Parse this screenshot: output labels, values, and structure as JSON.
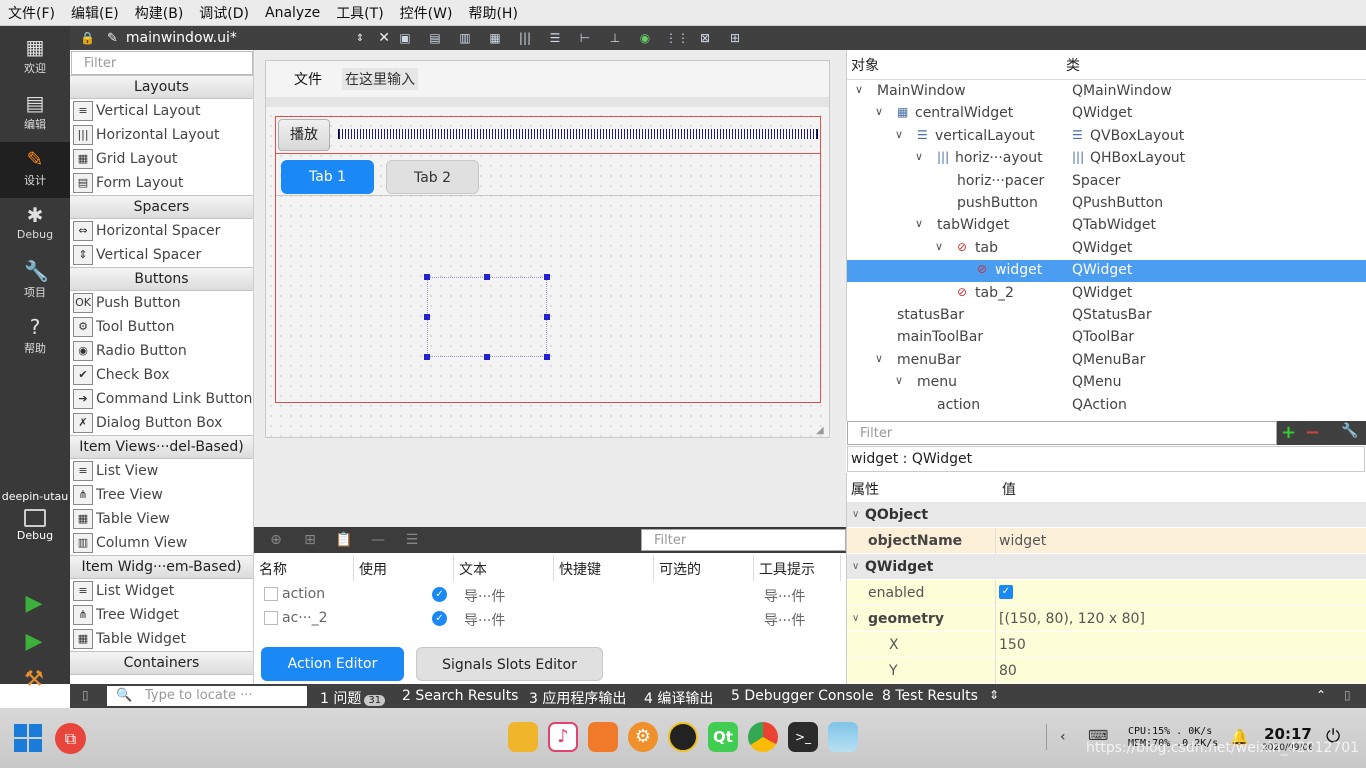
{
  "menubar": [
    "文件(F)",
    "编辑(E)",
    "构建(B)",
    "调试(D)",
    "Analyze",
    "工具(T)",
    "控件(W)",
    "帮助(H)"
  ],
  "modes": [
    {
      "label": "欢迎",
      "icon": "grid-icon"
    },
    {
      "label": "编辑",
      "icon": "document-icon"
    },
    {
      "label": "设计",
      "icon": "pencil-icon"
    },
    {
      "label": "Debug",
      "icon": "bug-icon"
    },
    {
      "label": "项目",
      "icon": "wrench-icon"
    },
    {
      "label": "帮助",
      "icon": "help-icon"
    }
  ],
  "kit": {
    "name": "deepin-utau",
    "mode": "Debug"
  },
  "editor": {
    "filename": "mainwindow.ui*"
  },
  "widgetbox": {
    "filter_placeholder": "Filter",
    "categories": [
      {
        "name": "Layouts",
        "items": [
          "Vertical Layout",
          "Horizontal Layout",
          "Grid Layout",
          "Form Layout"
        ]
      },
      {
        "name": "Spacers",
        "items": [
          "Horizontal Spacer",
          "Vertical Spacer"
        ]
      },
      {
        "name": "Buttons",
        "items": [
          "Push Button",
          "Tool Button",
          "Radio Button",
          "Check Box",
          "Command Link Button",
          "Dialog Button Box"
        ]
      },
      {
        "name": "Item Views···del-Based)",
        "items": [
          "List View",
          "Tree View",
          "Table View",
          "Column View"
        ]
      },
      {
        "name": "Item Widg···em-Based)",
        "items": [
          "List Widget",
          "Tree Widget",
          "Table Widget"
        ]
      },
      {
        "name": "Containers",
        "items": []
      }
    ]
  },
  "form": {
    "menu_file": "文件",
    "menu_typehere": "在这里输入",
    "play_button": "播放",
    "tab1": "Tab 1",
    "tab2": "Tab 2"
  },
  "action_editor": {
    "filter_placeholder": "Filter",
    "columns": [
      "名称",
      "使用",
      "文本",
      "快捷键",
      "可选的",
      "工具提示"
    ],
    "rows": [
      {
        "name": "action",
        "used": true,
        "text": "导···件",
        "tooltip": "导···件"
      },
      {
        "name": "ac···_2",
        "used": true,
        "text": "导···件",
        "tooltip": "导···件"
      }
    ],
    "tab_action": "Action Editor",
    "tab_signals": "Signals  Slots Editor"
  },
  "object_inspector": {
    "col_object": "对象",
    "col_class": "类",
    "rows": [
      {
        "object": "MainWindow",
        "class": "QMainWindow",
        "depth": 0,
        "exp": true
      },
      {
        "object": "centralWidget",
        "class": "QWidget",
        "depth": 1,
        "exp": true
      },
      {
        "object": "verticalLayout",
        "class": "QVBoxLayout",
        "depth": 2,
        "exp": true
      },
      {
        "object": "horiz···ayout",
        "class": "QHBoxLayout",
        "depth": 3,
        "exp": true
      },
      {
        "object": "horiz···pacer",
        "class": "Spacer",
        "depth": 4,
        "exp": false
      },
      {
        "object": "pushButton",
        "class": "QPushButton",
        "depth": 4,
        "exp": false
      },
      {
        "object": "tabWidget",
        "class": "QTabWidget",
        "depth": 3,
        "exp": true
      },
      {
        "object": "tab",
        "class": "QWidget",
        "depth": 4,
        "exp": true
      },
      {
        "object": "widget",
        "class": "QWidget",
        "depth": 5,
        "exp": false,
        "selected": true
      },
      {
        "object": "tab_2",
        "class": "QWidget",
        "depth": 4,
        "exp": false
      },
      {
        "object": "statusBar",
        "class": "QStatusBar",
        "depth": 1,
        "exp": false
      },
      {
        "object": "mainToolBar",
        "class": "QToolBar",
        "depth": 1,
        "exp": false
      },
      {
        "object": "menuBar",
        "class": "QMenuBar",
        "depth": 1,
        "exp": true
      },
      {
        "object": "menu",
        "class": "QMenu",
        "depth": 2,
        "exp": true
      },
      {
        "object": "action",
        "class": "QAction",
        "depth": 3,
        "exp": false
      }
    ]
  },
  "property_editor": {
    "filter_placeholder": "Filter",
    "object_label": "widget : QWidget",
    "col_property": "属性",
    "col_value": "值",
    "rows": [
      {
        "name": "QObject",
        "value": "",
        "kind": "group"
      },
      {
        "name": "objectName",
        "value": "widget",
        "kind": "bold"
      },
      {
        "name": "QWidget",
        "value": "",
        "kind": "group"
      },
      {
        "name": "enabled",
        "value": "",
        "kind": "check"
      },
      {
        "name": "geometry",
        "value": "[(150, 80), 120 x 80]",
        "kind": "boldexp"
      },
      {
        "name": "X",
        "value": "150",
        "kind": "sub"
      },
      {
        "name": "Y",
        "value": "80",
        "kind": "sub"
      }
    ]
  },
  "statusbar": {
    "locate_placeholder": "Type to locate ···",
    "tabs": [
      {
        "num": "1",
        "label": "问题",
        "badge": "31"
      },
      {
        "num": "2",
        "label": "Search Results"
      },
      {
        "num": "3",
        "label": "应用程序输出"
      },
      {
        "num": "4",
        "label": "编译输出"
      },
      {
        "num": "5",
        "label": "Debugger Console"
      },
      {
        "num": "8",
        "label": "Test Results"
      }
    ]
  },
  "taskbar": {
    "cpu": "CPU:15% .  0K/s",
    "mem": "MEM:70% .0.2K/s",
    "time": "20:17",
    "date": "2020/09/06",
    "watermark": "https://blog.csdn.net/weixin_42012701"
  }
}
